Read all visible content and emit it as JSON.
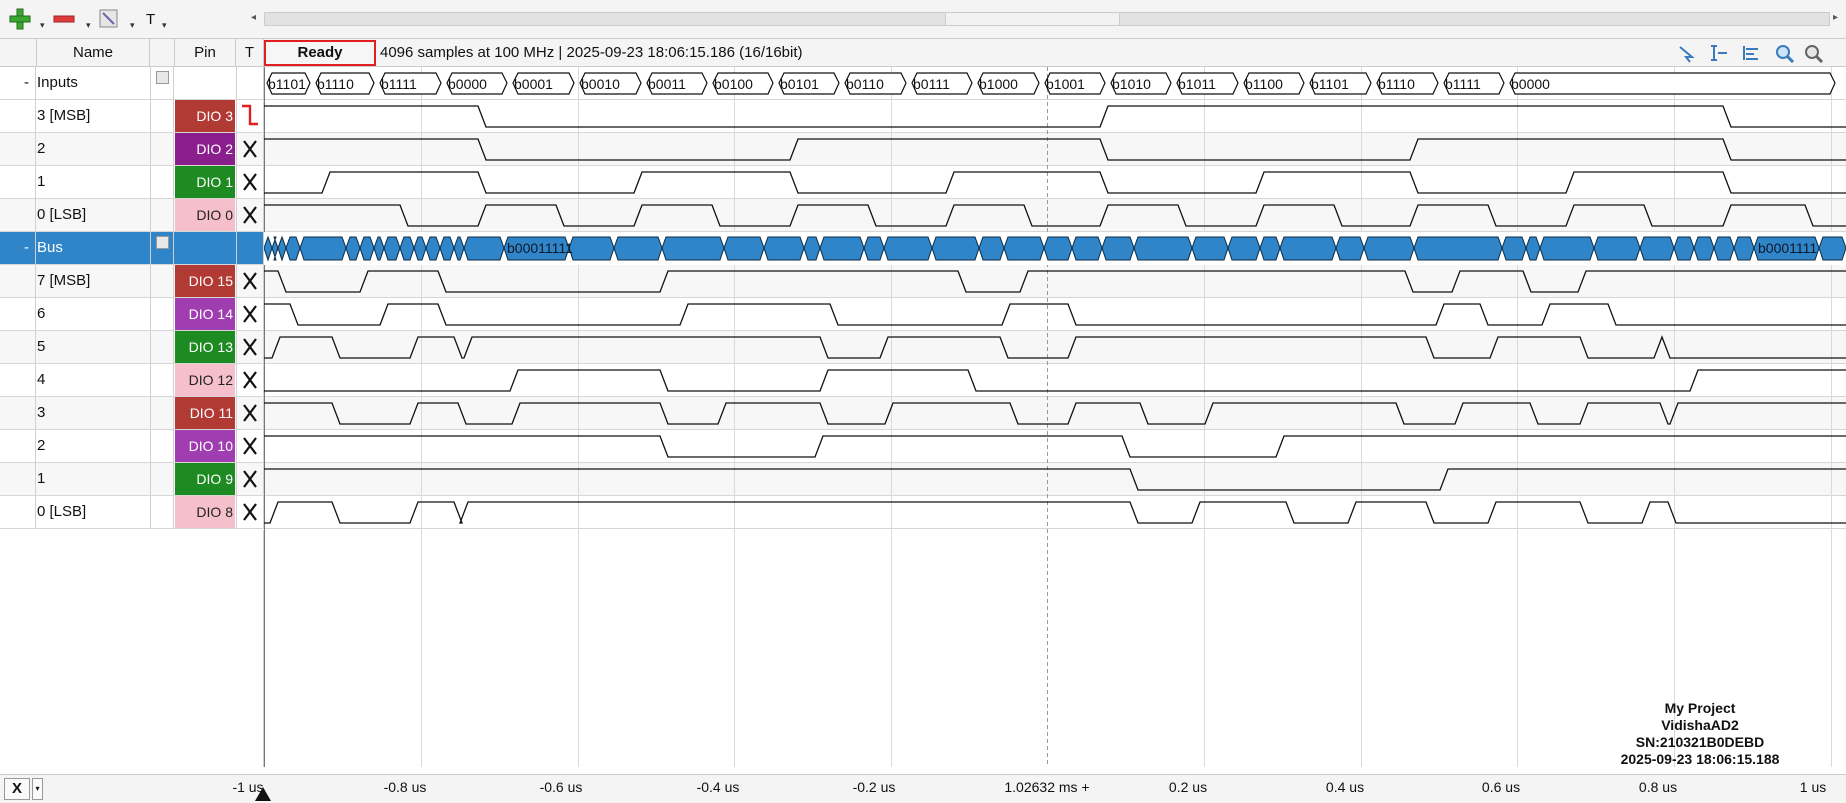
{
  "toolbar": {
    "add_icon": "plus-icon",
    "remove_icon": "minus-icon",
    "edit_icon": "pencil-icon",
    "text_label": "T"
  },
  "header": {
    "col_name": "Name",
    "col_pin": "Pin",
    "col_t": "T",
    "status": "Ready",
    "info": "4096 samples at 100 MHz | 2025-09-23 18:06:15.186 (16/16bit)"
  },
  "rows": [
    {
      "expander": "-",
      "name": "Inputs",
      "pin": "",
      "pin_color": "",
      "trigger": ""
    },
    {
      "expander": "",
      "name": "3 [MSB]",
      "pin": "DIO  3",
      "pin_color": "#b23a35",
      "trigger": "falling"
    },
    {
      "expander": "",
      "name": "2",
      "pin": "DIO  2",
      "pin_color": "#8a1e8c",
      "trigger": "X"
    },
    {
      "expander": "",
      "name": "1",
      "pin": "DIO  1",
      "pin_color": "#1d8a22",
      "trigger": "X"
    },
    {
      "expander": "",
      "name": "0 [LSB]",
      "pin": "DIO  0",
      "pin_color": "#f6bfcc",
      "trigger": "X"
    },
    {
      "expander": "-",
      "name": "Bus",
      "pin": "",
      "pin_color": "",
      "trigger": ""
    },
    {
      "expander": "",
      "name": "7 [MSB]",
      "pin": "DIO 15",
      "pin_color": "#b23a35",
      "trigger": "X"
    },
    {
      "expander": "",
      "name": "6",
      "pin": "DIO 14",
      "pin_color": "#a03db0",
      "trigger": "X"
    },
    {
      "expander": "",
      "name": "5",
      "pin": "DIO 13",
      "pin_color": "#1d8a22",
      "trigger": "X"
    },
    {
      "expander": "",
      "name": "4",
      "pin": "DIO 12",
      "pin_color": "#f6bfcc",
      "trigger": "X"
    },
    {
      "expander": "",
      "name": "3",
      "pin": "DIO 11",
      "pin_color": "#b23a35",
      "trigger": "X"
    },
    {
      "expander": "",
      "name": "2",
      "pin": "DIO 10",
      "pin_color": "#a03db0",
      "trigger": "X"
    },
    {
      "expander": "",
      "name": "1",
      "pin": "DIO  9",
      "pin_color": "#1d8a22",
      "trigger": "X"
    },
    {
      "expander": "",
      "name": "0 [LSB]",
      "pin": "DIO  8",
      "pin_color": "#f6bfcc",
      "trigger": "X"
    }
  ],
  "inputs_bus_values": [
    "b1101",
    "b1110",
    "b1111",
    "b0000",
    "b0001",
    "b0010",
    "b0011",
    "b0100",
    "b0101",
    "b0110",
    "b0111",
    "b1000",
    "b1001",
    "b1010",
    "b1011",
    "b1100",
    "b1101",
    "b1110",
    "b1111",
    "b0000"
  ],
  "bus_labels": [
    "b00011111",
    "b0001111"
  ],
  "x_axis": {
    "ticks": [
      "-1 us",
      "-0.8 us",
      "-0.6 us",
      "-0.4 us",
      "-0.2 us",
      "1.02632 ms +",
      "0.2 us",
      "0.4 us",
      "0.6 us",
      "0.8 us",
      "1 us"
    ]
  },
  "project": {
    "name": "My Project",
    "device": "VidishaAD2",
    "serial": "SN:210321B0DEBD",
    "timestamp": "2025-09-23 18:06:15.188"
  },
  "bottom": {
    "x_button": "X"
  },
  "colors": {
    "selection": "#3085c9",
    "trigger_edge": "#e02020",
    "status_border": "#e02020"
  }
}
